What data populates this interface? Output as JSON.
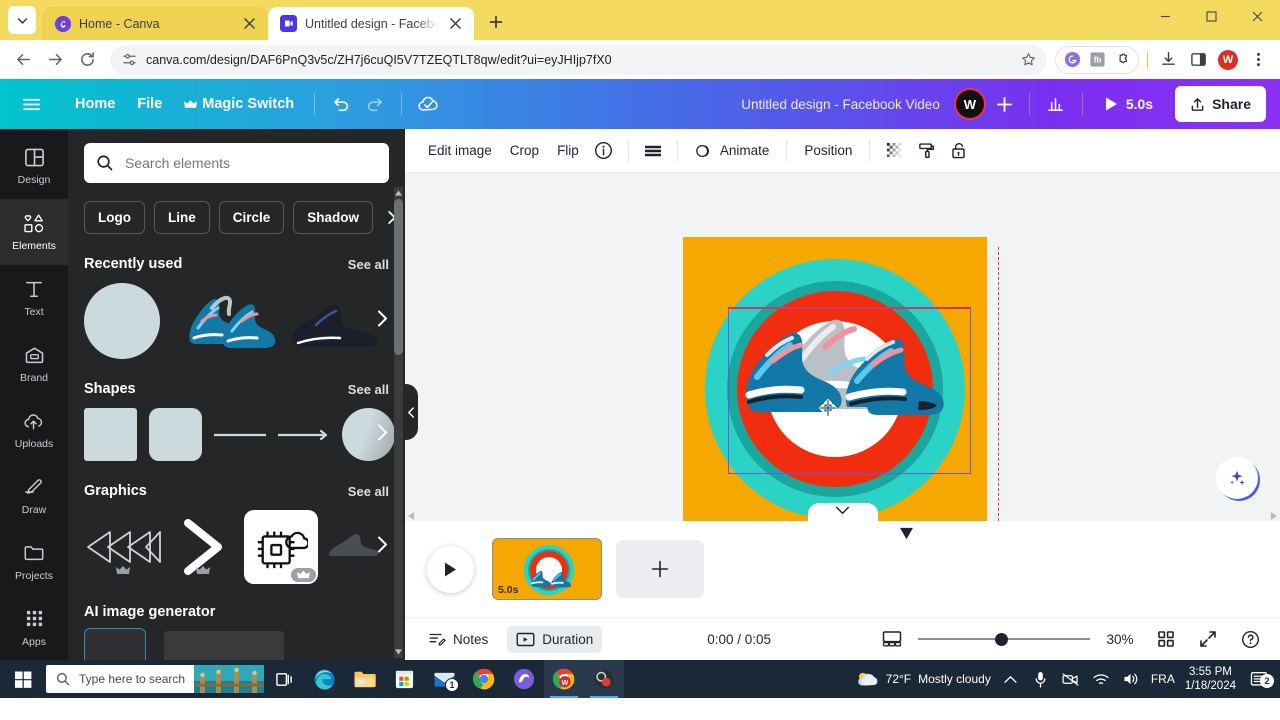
{
  "browser": {
    "tabs": [
      {
        "title": "Home - Canva",
        "favicon": "canva-icon",
        "active": false
      },
      {
        "title": "Untitled design - Facebook Vide",
        "favicon": "canva-video-icon",
        "active": true
      }
    ],
    "new_tab_label": "+",
    "url": "canva.com/design/DAF6PnQ3v5c/ZH7j6cuQI5V7TZEQTLT8qw/edit?ui=eyJHIjp7fX0",
    "profile_initial": "W",
    "colors": {
      "tabstrip": "#f5da62",
      "inactive_tab": "#f0d253"
    }
  },
  "canva_header": {
    "menu_items": [
      "Home",
      "File",
      "Magic Switch"
    ],
    "title": "Untitled design - Facebook Video",
    "avatar_initial": "W",
    "duration_label": "5.0s",
    "share_label": "Share"
  },
  "rail": {
    "items": [
      {
        "label": "Design",
        "icon": "design-icon",
        "active": false
      },
      {
        "label": "Elements",
        "icon": "elements-icon",
        "active": true
      },
      {
        "label": "Text",
        "icon": "text-icon",
        "active": false
      },
      {
        "label": "Brand",
        "icon": "brand-icon",
        "active": false
      },
      {
        "label": "Uploads",
        "icon": "uploads-icon",
        "active": false
      },
      {
        "label": "Draw",
        "icon": "draw-icon",
        "active": false
      },
      {
        "label": "Projects",
        "icon": "projects-icon",
        "active": false
      },
      {
        "label": "Apps",
        "icon": "apps-icon",
        "active": false
      }
    ]
  },
  "panel": {
    "search_placeholder": "Search elements",
    "pills": [
      "Logo",
      "Line",
      "Circle",
      "Shadow"
    ],
    "sections": [
      {
        "title": "Recently used",
        "see_all": "See all"
      },
      {
        "title": "Shapes",
        "see_all": "See all"
      },
      {
        "title": "Graphics",
        "see_all": "See all"
      },
      {
        "title": "AI image generator",
        "see_all": ""
      }
    ]
  },
  "editor_toolbar": {
    "items": [
      "Edit image",
      "Crop",
      "Flip"
    ],
    "animate_label": "Animate",
    "position_label": "Position",
    "icons": [
      "info-icon",
      "menu-lines-icon",
      "animate-icon",
      "transparency-icon",
      "paint-roller-icon",
      "lock-icon"
    ]
  },
  "canvas": {
    "artboard_colors": {
      "background": "#f5a800",
      "ring_outer_teal": "#2ad3c5",
      "ring_inner_teal": "#1aa79e",
      "ring_red": "#f02d0f",
      "center_white": "#ffffff"
    },
    "selection_color": "#6a5ae0",
    "guide_color": "#d6326b"
  },
  "pages_bar": {
    "page_duration": "5.0s",
    "add_page_label": "+"
  },
  "status_bar": {
    "notes_label": "Notes",
    "duration_label": "Duration",
    "time": "0:00 / 0:05",
    "zoom": "30%"
  },
  "taskbar": {
    "search_placeholder": "Type here to search",
    "apps": [
      "task-view-icon",
      "edge-icon",
      "file-explorer-icon",
      "microsoft-store-icon",
      "mail-icon",
      "chrome-icon",
      "copilot-icon",
      "chrome-canva-icon",
      "obs-icon"
    ],
    "mail_badge": "1",
    "weather_temp": "72°F",
    "weather_desc": "Mostly cloudy",
    "language": "FRA",
    "clock_time": "3:55 PM",
    "clock_date": "1/18/2024",
    "notification_count": "2"
  }
}
